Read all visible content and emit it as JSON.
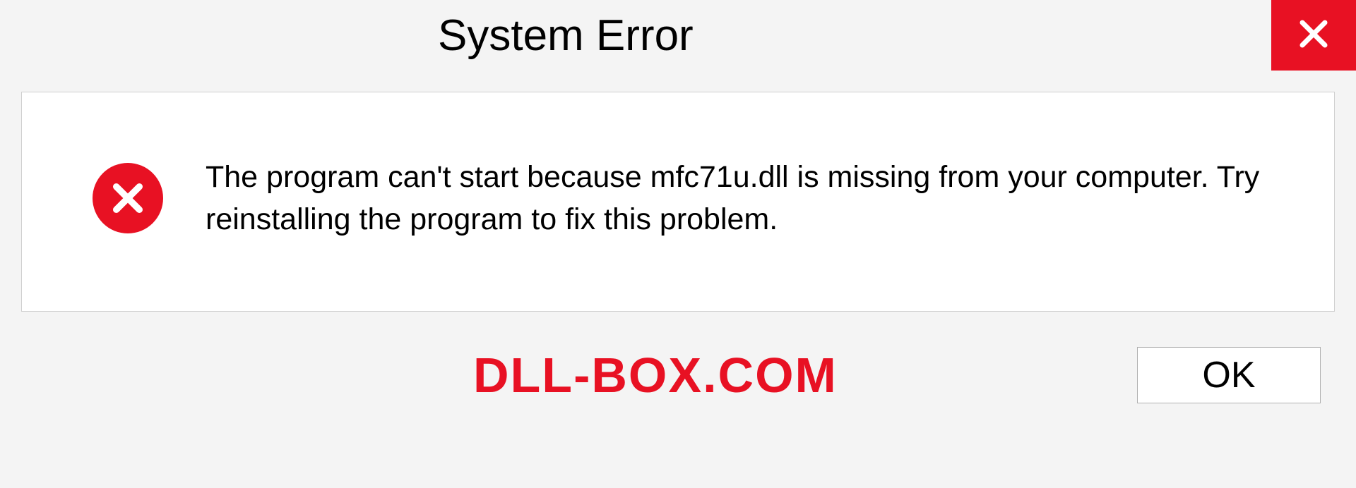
{
  "dialog": {
    "title": "System Error",
    "message": "The program can't start because mfc71u.dll is missing from your computer. Try reinstalling the program to fix this problem.",
    "ok_label": "OK"
  },
  "watermark": "DLL-BOX.COM"
}
